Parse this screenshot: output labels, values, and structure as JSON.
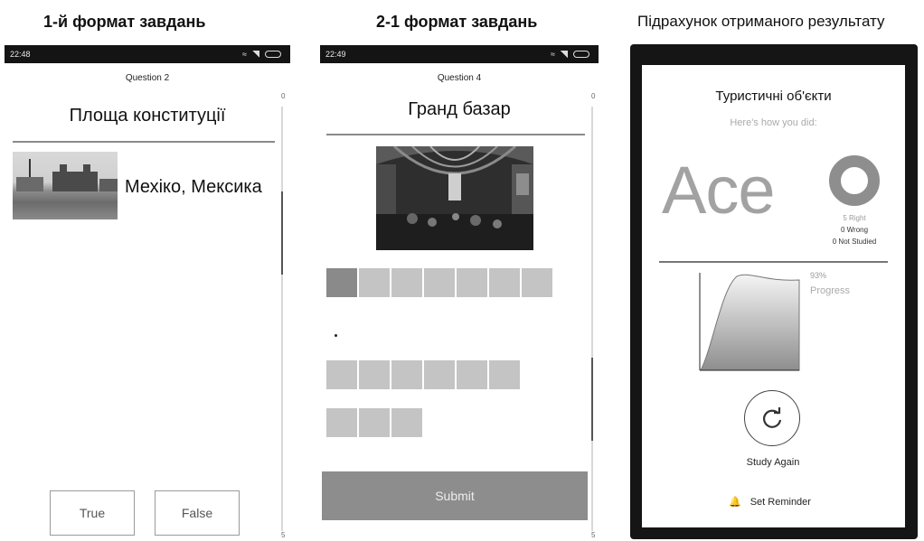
{
  "headings": {
    "format1": "1-й формат завдань",
    "format2": "2-1 формат завдань",
    "result": "Підрахунок отриманого результату"
  },
  "phone1": {
    "time": "22:48",
    "question_label": "Question 2",
    "title": "Площа конституції",
    "answer": "Мехіко, Мексика",
    "scroll_top": "0",
    "scroll_bottom": "5",
    "true_label": "True",
    "false_label": "False",
    "photo_icon": "city-square-photo"
  },
  "phone2": {
    "time": "22:49",
    "question_label": "Question 4",
    "title": "Гранд базар",
    "scroll_top": "0",
    "scroll_bottom": "5",
    "submit_label": "Submit",
    "photo_icon": "bazaar-photo",
    "tile_rows": [
      7,
      6,
      3
    ]
  },
  "phone3": {
    "title": "Туристичні об'єкти",
    "subtitle": "Here's how you did:",
    "grade": "Ace",
    "right": "5 Right",
    "wrong": "0 Wrong",
    "not_studied": "0 Not Studied",
    "progress_pct": "93%",
    "progress_label": "Progress",
    "study_again": "Study Again",
    "set_reminder": "Set Reminder",
    "progress_value": 0.93
  },
  "colors": {
    "statusbar": "#141414",
    "submit": "#8d8d8d",
    "tile": "#c4c4c4",
    "tile_selected": "#8a8a8a",
    "donut": "#8e8e8e"
  }
}
